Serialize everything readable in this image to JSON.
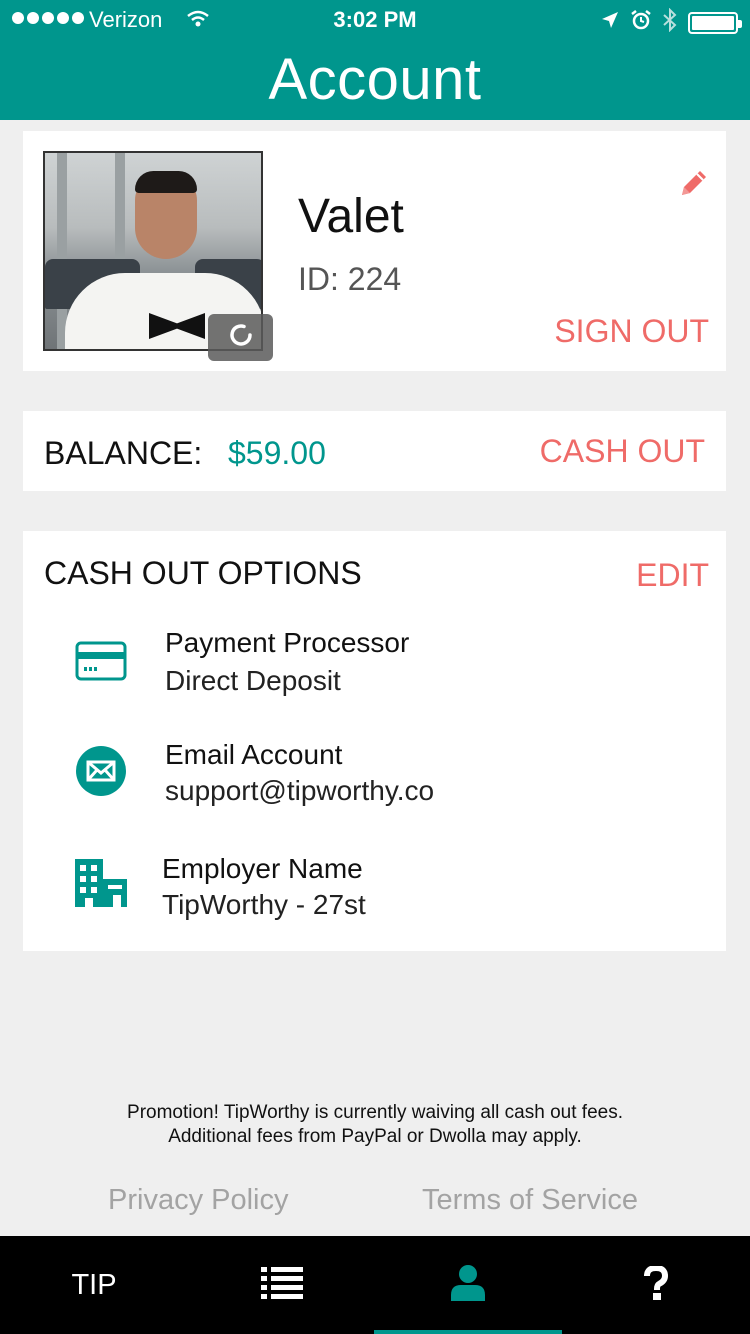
{
  "status_bar": {
    "carrier": "Verizon",
    "time": "3:02 PM",
    "battery_level": 1.0
  },
  "header": {
    "title": "Account"
  },
  "profile": {
    "name": "Valet",
    "id_text": "ID: 224",
    "sign_out_label": "SIGN OUT"
  },
  "balance": {
    "label": "BALANCE:",
    "value": "$59.00",
    "cash_out_label": "CASH OUT"
  },
  "cash_out_options": {
    "title": "CASH OUT OPTIONS",
    "edit_label": "EDIT",
    "items": [
      {
        "icon": "credit-card-icon",
        "label": "Payment Processor",
        "value": "Direct Deposit"
      },
      {
        "icon": "email-icon",
        "label": "Email Account",
        "value": "support@tipworthy.co"
      },
      {
        "icon": "building-icon",
        "label": "Employer Name",
        "value": "TipWorthy - 27st"
      }
    ]
  },
  "promo": {
    "line1": "Promotion! TipWorthy is currently waiving all cash out fees.",
    "line2": "Additional fees from PayPal or Dwolla may apply."
  },
  "footer": {
    "privacy_label": "Privacy Policy",
    "terms_label": "Terms of Service"
  },
  "tab_bar": {
    "tip_label": "TIP",
    "active_tab": "account"
  },
  "colors": {
    "brand": "#00968d",
    "accent": "#ef6b68",
    "tab_bar": "#000000",
    "background": "#efefef"
  }
}
